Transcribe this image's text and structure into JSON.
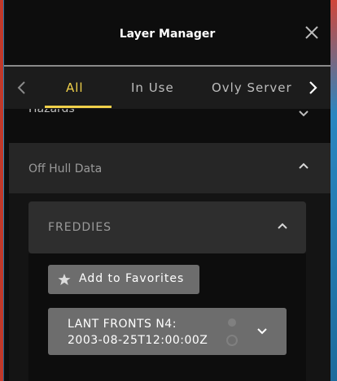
{
  "header": {
    "title": "Layer Manager",
    "close_icon": "close-icon"
  },
  "tabs": {
    "items": [
      {
        "label": "All",
        "active": true
      },
      {
        "label": "In Use",
        "active": false
      },
      {
        "label": "Ovly Server",
        "active": false
      }
    ],
    "accent": "#f0d04a"
  },
  "sections": {
    "hazards": {
      "label": "Hazards"
    },
    "off_hull": {
      "label": "Off Hull Data",
      "expanded": true
    },
    "freddies": {
      "label": "FREDDIES",
      "expanded": true
    }
  },
  "favorites": {
    "label": "Add to Favorites",
    "icon": "star-icon"
  },
  "layer": {
    "name": "LANT FRONTS N4:\n2003-08-25T12:00:00Z",
    "icon": "chevron-down-icon"
  }
}
